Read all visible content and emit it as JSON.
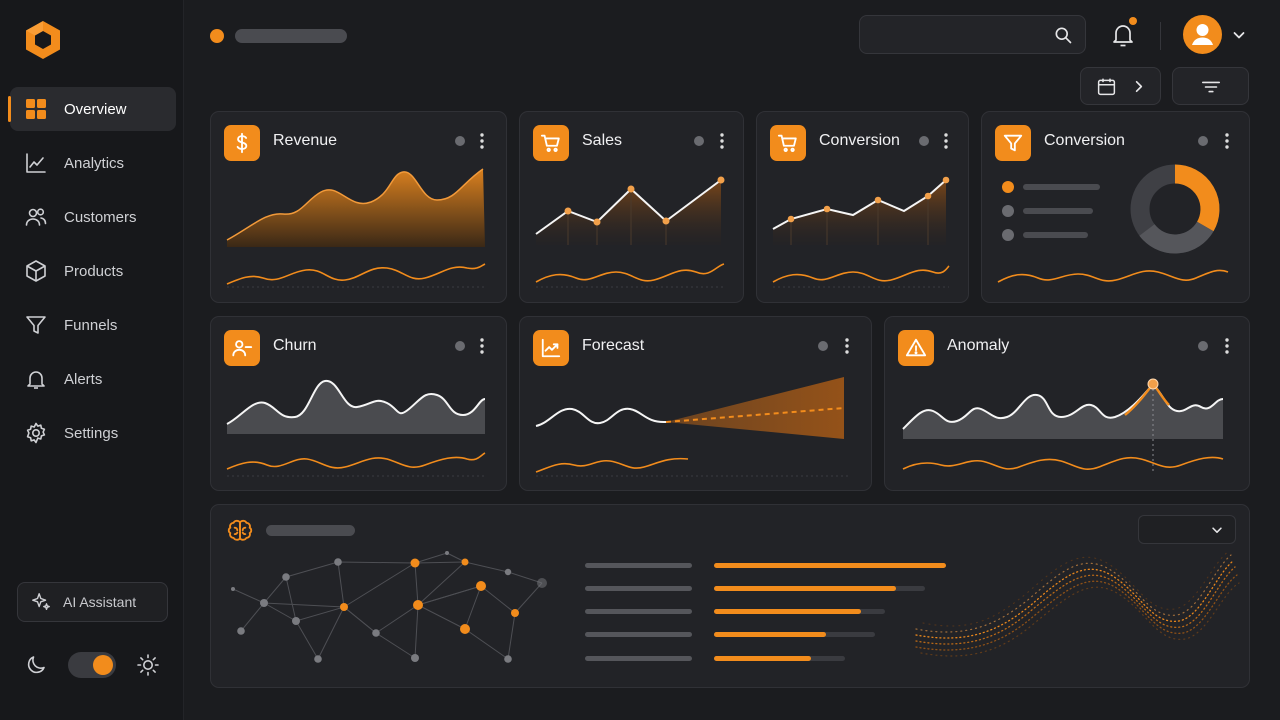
{
  "sidebar": {
    "items": [
      {
        "label": "Overview",
        "icon": "grid-icon",
        "active": true
      },
      {
        "label": "Analytics",
        "icon": "chart-line-icon"
      },
      {
        "label": "Customers",
        "icon": "users-icon"
      },
      {
        "label": "Products",
        "icon": "cube-icon"
      },
      {
        "label": "Funnels",
        "icon": "funnel-icon"
      },
      {
        "label": "Alerts",
        "icon": "bell-icon"
      },
      {
        "label": "Settings",
        "icon": "gear-icon"
      }
    ],
    "ai_assistant_label": "AI Assistant",
    "theme_toggle_state": "on"
  },
  "header": {
    "search_value": "",
    "notifications_unread": true
  },
  "colors": {
    "accent": "#f28c1c",
    "background": "#1b1c1f",
    "card": "#222327",
    "muted": "#6a6b70"
  },
  "cards": {
    "revenue": {
      "title": "Revenue",
      "icon": "dollar-icon"
    },
    "sales": {
      "title": "Sales",
      "icon": "cart-icon"
    },
    "conversion_1": {
      "title": "Conversion",
      "icon": "cart-icon"
    },
    "conversion_2": {
      "title": "Conversion",
      "icon": "funnel-icon"
    },
    "churn": {
      "title": "Churn",
      "icon": "user-minus-icon"
    },
    "forecast": {
      "title": "Forecast",
      "icon": "trend-icon"
    },
    "anomaly": {
      "title": "Anomaly",
      "icon": "warning-icon"
    },
    "insights": {
      "icon": "brain-icon"
    }
  }
}
